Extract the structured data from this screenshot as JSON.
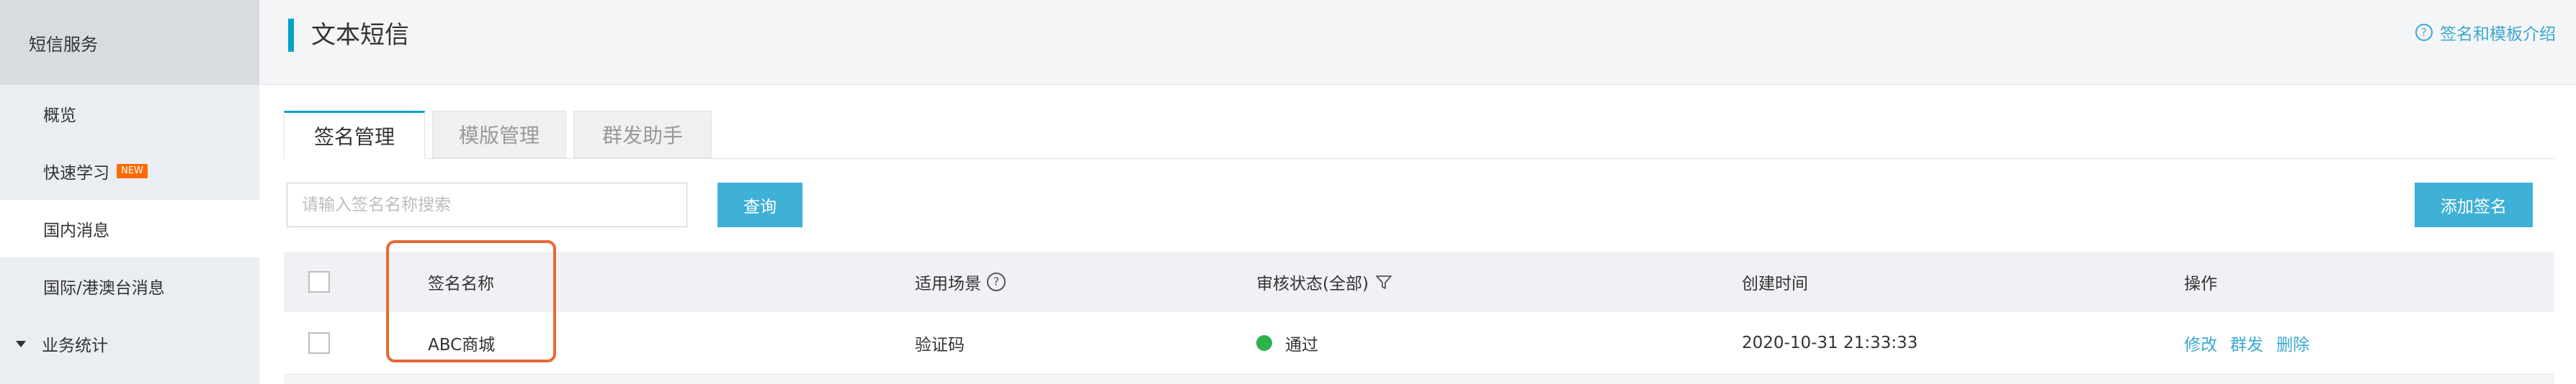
{
  "sidebar": {
    "title": "短信服务",
    "items": [
      {
        "label": "概览"
      },
      {
        "label": "快速学习",
        "badge": "NEW"
      },
      {
        "label": "国内消息",
        "active": true
      },
      {
        "label": "国际/港澳台消息"
      },
      {
        "label": "业务统计",
        "group": true
      }
    ]
  },
  "header": {
    "title": "文本短信",
    "help_link": "签名和模板介绍",
    "help_icon": "?"
  },
  "tabs": [
    {
      "label": "签名管理",
      "active": true
    },
    {
      "label": "模版管理"
    },
    {
      "label": "群发助手"
    }
  ],
  "search": {
    "placeholder": "请输入签名名称搜索",
    "query_label": "查询",
    "add_label": "添加签名"
  },
  "table": {
    "columns": {
      "name": "签名名称",
      "scene": "适用场景",
      "status": "审核状态(全部)",
      "created": "创建时间",
      "actions": "操作"
    },
    "rows": [
      {
        "name": "ABC商城",
        "scene": "验证码",
        "status": "通过",
        "created": "2020-10-31 21:33:33",
        "actions": [
          "修改",
          "群发",
          "删除"
        ]
      }
    ]
  },
  "colors": {
    "accent": "#3fb0d6",
    "link": "#3da8d1",
    "status_ok": "#2fb14d",
    "highlight": "#e76a35",
    "badge": "#ff6a00"
  }
}
